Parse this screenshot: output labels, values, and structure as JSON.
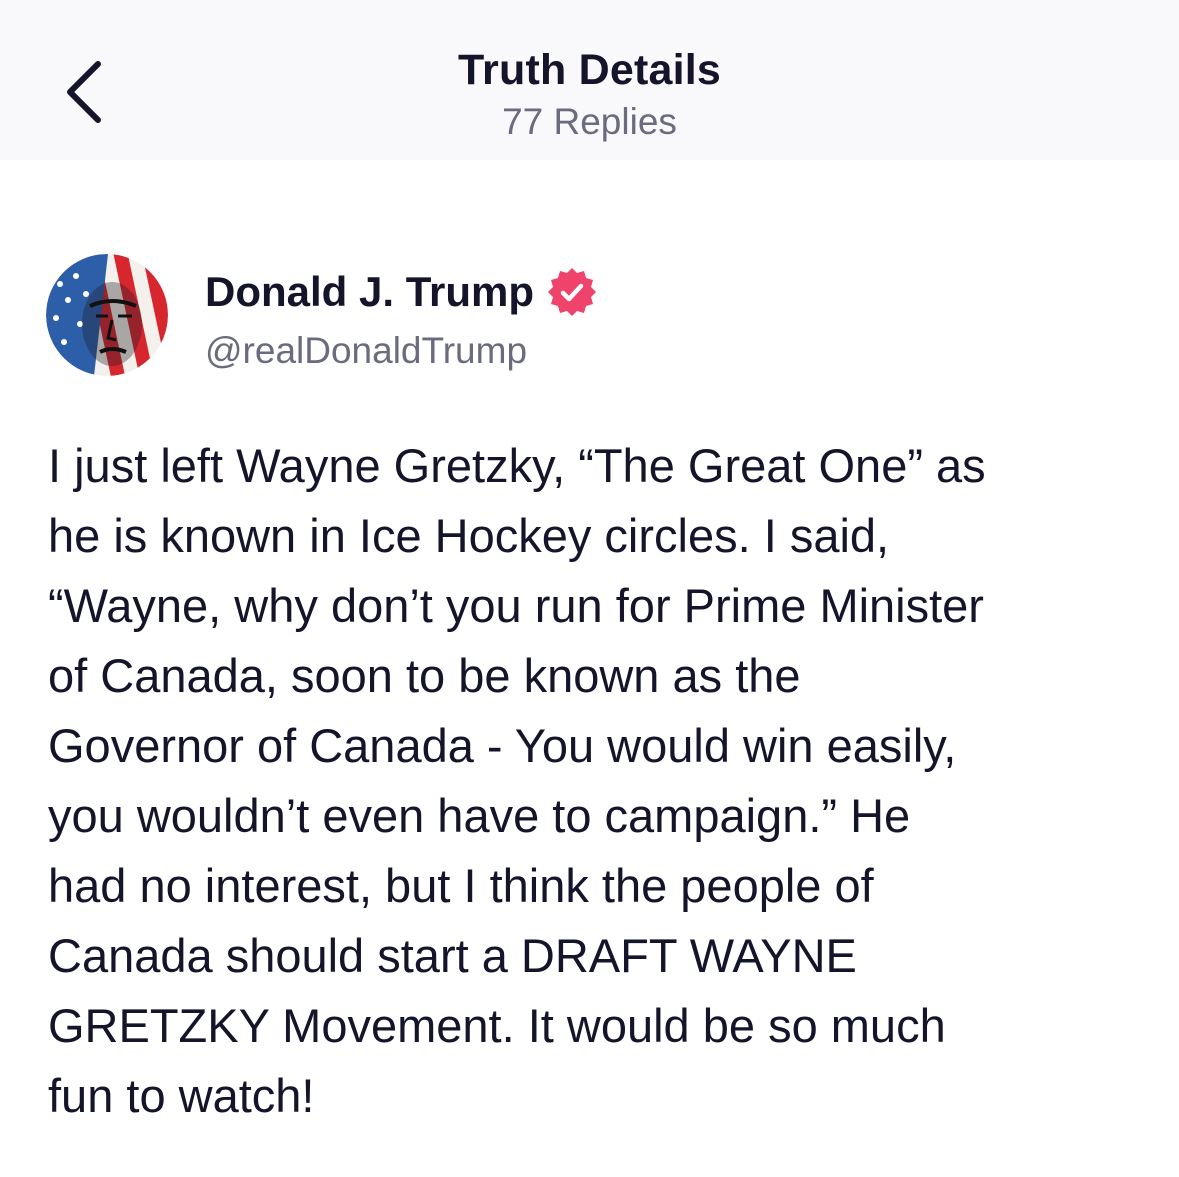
{
  "header": {
    "title": "Truth Details",
    "subtitle": "77 Replies",
    "back_icon": "chevron-left-icon"
  },
  "author": {
    "name": "Donald J. Trump",
    "handle": "@realDonaldTrump",
    "verified_icon": "verified-badge-icon",
    "badge_color": "#f0436b"
  },
  "post": {
    "lines": [
      "I just left Wayne Gretzky, “The Great One” as",
      "he is known in Ice Hockey circles. I said,",
      "“Wayne, why don’t you run for Prime Minister",
      "of Canada, soon to be known as the",
      "Governor of Canada - You would win easily,",
      "you wouldn’t even have to campaign.” He",
      "had no interest, but I think the people of",
      "Canada should start a DRAFT WAYNE",
      "GRETZKY Movement. It would be so much",
      "fun to watch!"
    ]
  },
  "colors": {
    "text": "#14142b",
    "muted": "#6b6b80",
    "header_bg": "#f9f9fb"
  }
}
